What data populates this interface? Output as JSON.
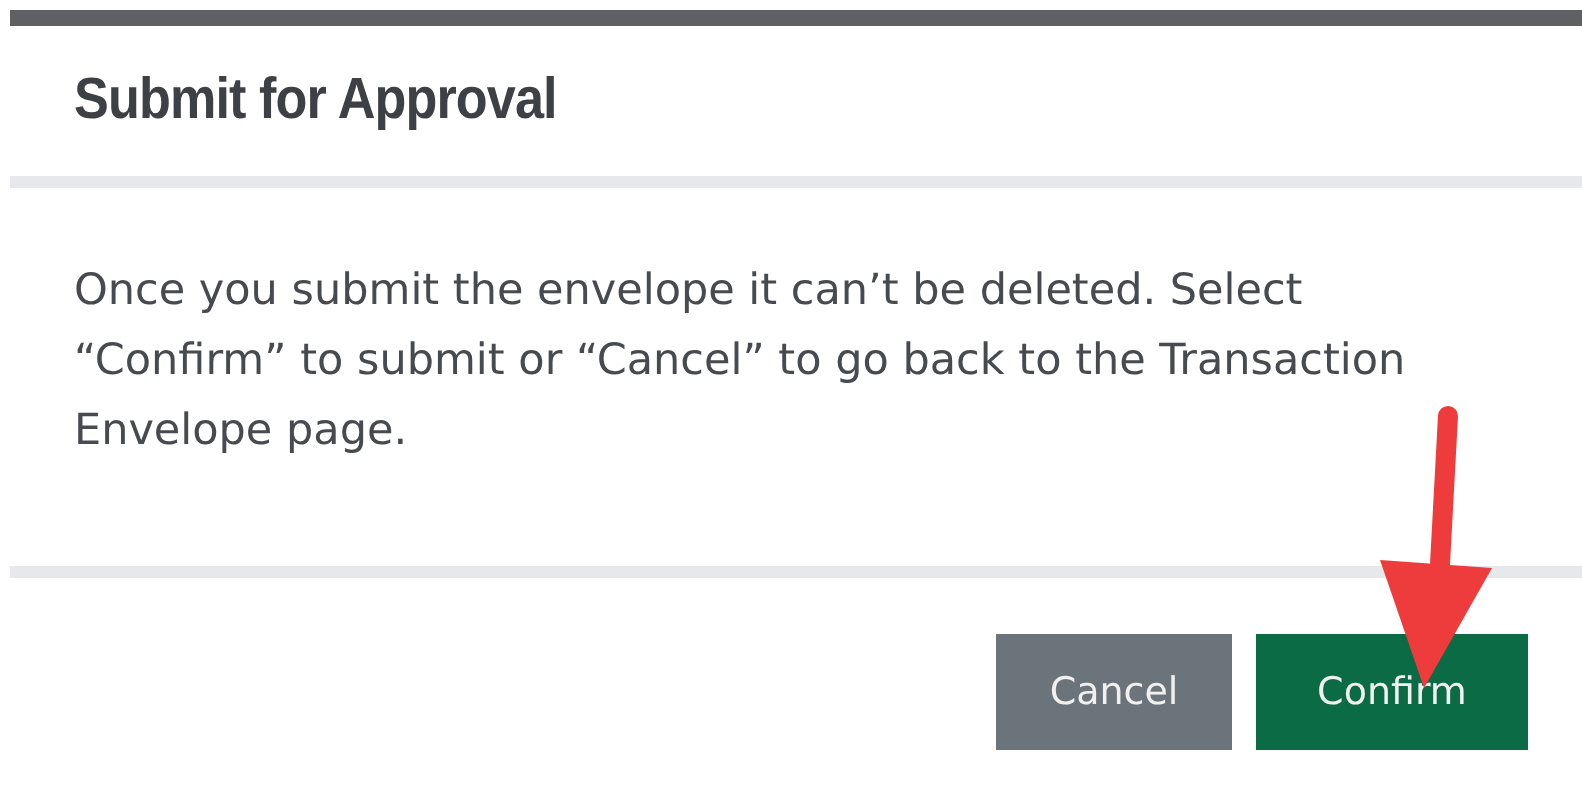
{
  "dialog": {
    "title": "Submit for Approval",
    "message": "Once you submit the envelope it can’t be deleted. Select “Confirm” to submit or “Cancel” to go back to the Transaction Envelope page.",
    "buttons": [
      {
        "label": "Cancel",
        "kind": "secondary"
      },
      {
        "label": "Confirm",
        "kind": "primary"
      }
    ]
  }
}
